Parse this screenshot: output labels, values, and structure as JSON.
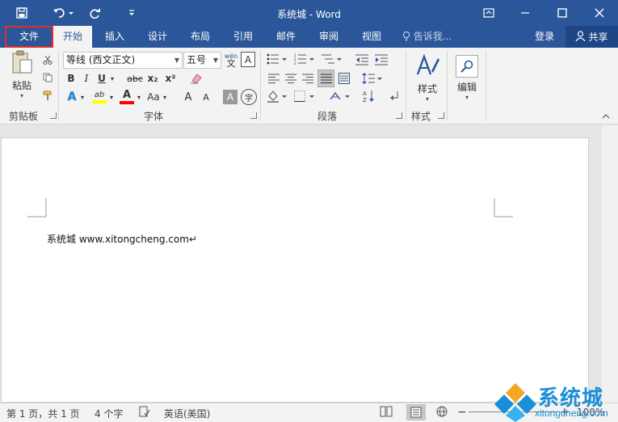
{
  "window": {
    "title": "系统城 - Word"
  },
  "tabs": [
    {
      "label": "文件"
    },
    {
      "label": "开始"
    },
    {
      "label": "插入"
    },
    {
      "label": "设计"
    },
    {
      "label": "布局"
    },
    {
      "label": "引用"
    },
    {
      "label": "邮件"
    },
    {
      "label": "审阅"
    },
    {
      "label": "视图"
    }
  ],
  "tell_me": {
    "placeholder": "告诉我..."
  },
  "account": {
    "login": "登录",
    "share": "共享"
  },
  "ribbon": {
    "clipboard": {
      "label": "剪贴板",
      "paste": "粘贴"
    },
    "font": {
      "label": "字体",
      "font_name": "等线 (西文正文)",
      "font_size": "五号",
      "bold": "B",
      "italic": "I",
      "underline": "U",
      "strike": "abc",
      "subscript": "x₂",
      "superscript": "x²",
      "change_case": "Aa",
      "grow": "A",
      "shrink": "A",
      "wen": "wén",
      "wen_char": "文",
      "char_border": "A",
      "char_shade": "A",
      "enclose": "字",
      "highlight_letter": "ab",
      "font_color_letter": "A",
      "effects_letter": "A"
    },
    "paragraph": {
      "label": "段落"
    },
    "styles": {
      "label": "样式",
      "button": "样式"
    },
    "editing": {
      "button": "编辑"
    }
  },
  "document": {
    "text": "系统城 www.xitongcheng.com↵"
  },
  "statusbar": {
    "page": "第 1 页，共 1 页",
    "words": "4 个字",
    "language": "英语(美国)",
    "zoom": "100%"
  },
  "watermark": {
    "brand": "系统城",
    "url": "xitongcheng.com"
  },
  "colors": {
    "word_blue": "#2b579a",
    "highlight_red": "#e52d27",
    "highlight_yellow": "#ffff00",
    "font_red": "#ff0000"
  }
}
